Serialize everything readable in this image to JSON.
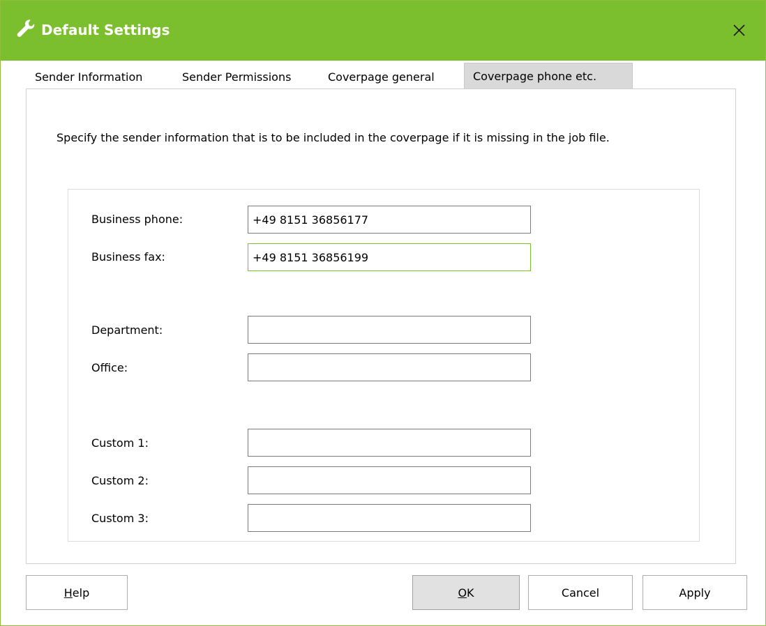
{
  "window": {
    "title": "Default Settings",
    "title_icon": "wrench-icon",
    "close_icon": "close-icon",
    "titlebar_color": "#7cbf2e",
    "focus_color": "#7cbf2e"
  },
  "tabs": [
    {
      "label": "Sender Information",
      "active": false
    },
    {
      "label": "Sender Permissions",
      "active": false
    },
    {
      "label": "Coverpage general",
      "active": false
    },
    {
      "label": "Coverpage phone etc.",
      "active": true
    }
  ],
  "description": "Specify the sender information that is to be included in the coverpage if it is missing in the job file.",
  "fields": {
    "business_phone": {
      "label": "Business phone:",
      "value": "+49 8151 36856177"
    },
    "business_fax": {
      "label": "Business fax:",
      "value": "+49 8151 36856199"
    },
    "department": {
      "label": "Department:",
      "value": ""
    },
    "office": {
      "label": "Office:",
      "value": ""
    },
    "custom1": {
      "label": "Custom 1:",
      "value": ""
    },
    "custom2": {
      "label": "Custom 2:",
      "value": ""
    },
    "custom3": {
      "label": "Custom 3:",
      "value": ""
    }
  },
  "buttons": {
    "help": {
      "mnemonic": "H",
      "rest": "elp"
    },
    "ok": {
      "mnemonic": "O",
      "rest": "K"
    },
    "cancel": "Cancel",
    "apply": "Apply"
  }
}
